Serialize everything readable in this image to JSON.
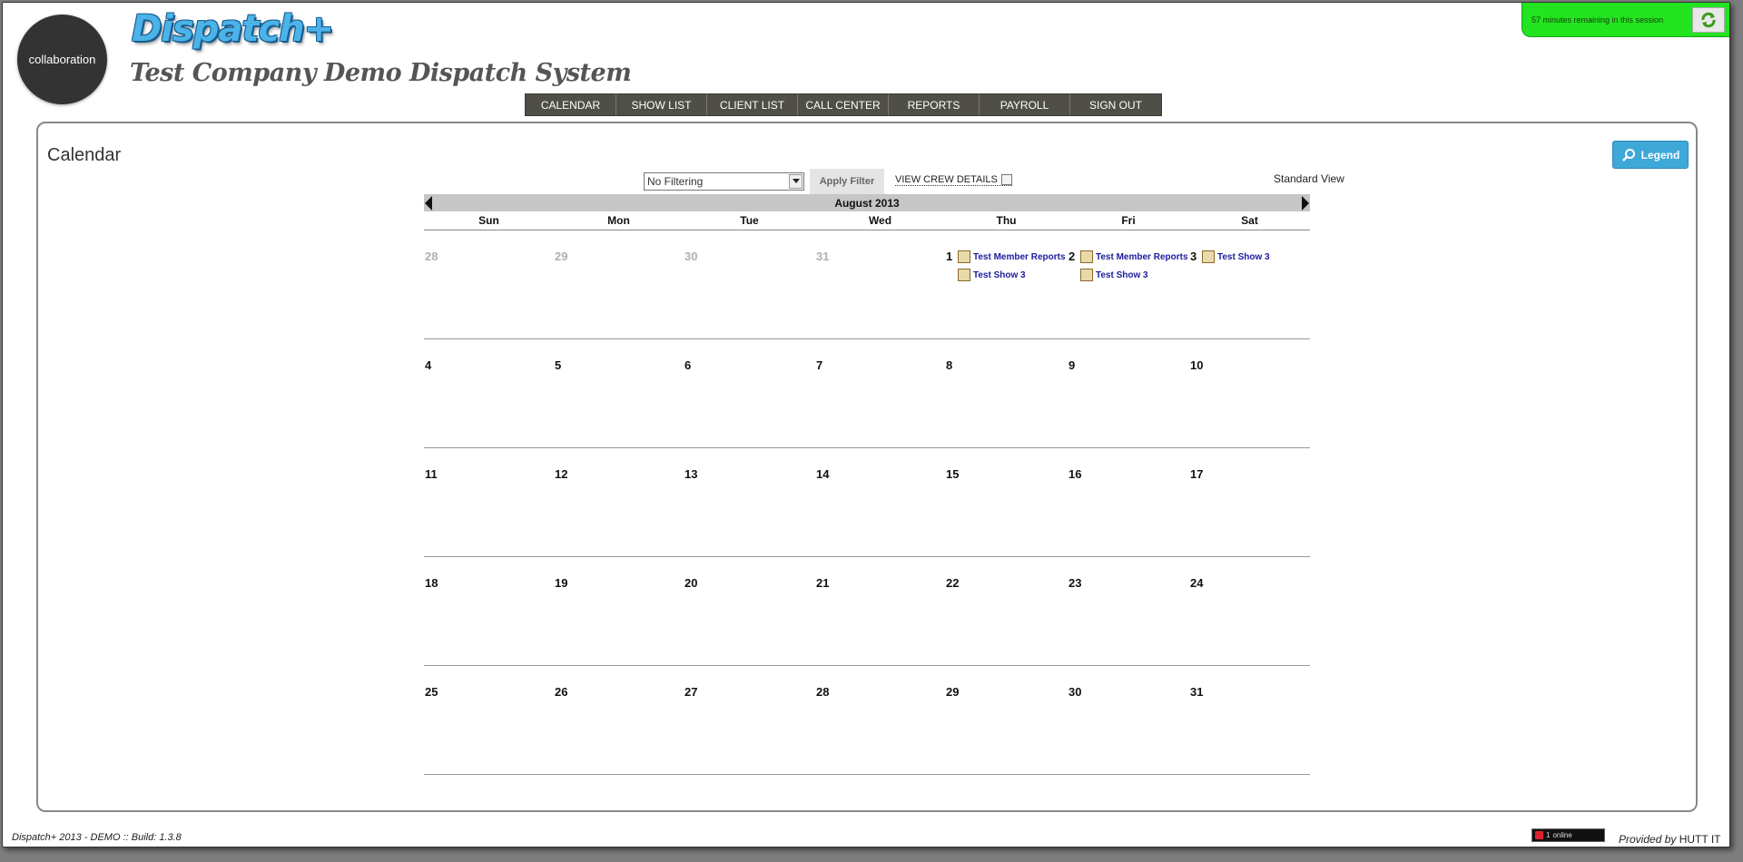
{
  "header": {
    "logo_text": "collaboration",
    "app_logo": "Dispatch+",
    "company_title": "Test Company Demo Dispatch System"
  },
  "nav": [
    "CALENDAR",
    "SHOW LIST",
    "CLIENT LIST",
    "CALL CENTER",
    "REPORTS",
    "PAYROLL",
    "SIGN OUT"
  ],
  "session": {
    "text": "57 minutes remaining in this session",
    "refresh_icon": "refresh-icon"
  },
  "main": {
    "title": "Calendar",
    "legend_label": "Legend",
    "filter": {
      "selected": "No Filtering"
    },
    "apply_filter_label": "Apply Filter",
    "crew_details_label": "VIEW CREW DETAILS",
    "view_mode": "Standard View"
  },
  "calendar": {
    "month_label": "August 2013",
    "days_of_week": [
      "Sun",
      "Mon",
      "Tue",
      "Wed",
      "Thu",
      "Fri",
      "Sat"
    ],
    "weeks": [
      [
        {
          "day": "28",
          "muted": true,
          "events": []
        },
        {
          "day": "29",
          "muted": true,
          "events": []
        },
        {
          "day": "30",
          "muted": true,
          "events": []
        },
        {
          "day": "31",
          "muted": true,
          "events": []
        },
        {
          "day": "1",
          "muted": false,
          "events": [
            "Test Member Reports",
            "Test Show 3"
          ]
        },
        {
          "day": "2",
          "muted": false,
          "events": [
            "Test Member Reports",
            "Test Show 3"
          ]
        },
        {
          "day": "3",
          "muted": false,
          "events": [
            "Test Show 3"
          ]
        }
      ],
      [
        {
          "day": "4",
          "muted": false,
          "events": []
        },
        {
          "day": "5",
          "muted": false,
          "events": []
        },
        {
          "day": "6",
          "muted": false,
          "events": []
        },
        {
          "day": "7",
          "muted": false,
          "events": []
        },
        {
          "day": "8",
          "muted": false,
          "events": []
        },
        {
          "day": "9",
          "muted": false,
          "events": []
        },
        {
          "day": "10",
          "muted": false,
          "events": []
        }
      ],
      [
        {
          "day": "11",
          "muted": false,
          "events": []
        },
        {
          "day": "12",
          "muted": false,
          "events": []
        },
        {
          "day": "13",
          "muted": false,
          "events": []
        },
        {
          "day": "14",
          "muted": false,
          "events": []
        },
        {
          "day": "15",
          "muted": false,
          "events": []
        },
        {
          "day": "16",
          "muted": false,
          "events": []
        },
        {
          "day": "17",
          "muted": false,
          "events": []
        }
      ],
      [
        {
          "day": "18",
          "muted": false,
          "events": []
        },
        {
          "day": "19",
          "muted": false,
          "events": []
        },
        {
          "day": "20",
          "muted": false,
          "events": []
        },
        {
          "day": "21",
          "muted": false,
          "events": []
        },
        {
          "day": "22",
          "muted": false,
          "events": []
        },
        {
          "day": "23",
          "muted": false,
          "events": []
        },
        {
          "day": "24",
          "muted": false,
          "events": []
        }
      ],
      [
        {
          "day": "25",
          "muted": false,
          "events": []
        },
        {
          "day": "26",
          "muted": false,
          "events": []
        },
        {
          "day": "27",
          "muted": false,
          "events": []
        },
        {
          "day": "28",
          "muted": false,
          "events": []
        },
        {
          "day": "29",
          "muted": false,
          "events": []
        },
        {
          "day": "30",
          "muted": false,
          "events": []
        },
        {
          "day": "31",
          "muted": false,
          "events": []
        }
      ]
    ]
  },
  "footer": {
    "left": "Dispatch+ 2013 - DEMO :: Build: 1.3.8",
    "online_count": "1",
    "online_label": "online",
    "provided_prefix": "Provided by",
    "provided_by": "HUTT IT"
  },
  "colors": {
    "nav_bg": "#4f4f48",
    "session_bg": "#22e41f",
    "legend_bg": "#3ea8d8",
    "event_link": "#1b1b9e"
  }
}
